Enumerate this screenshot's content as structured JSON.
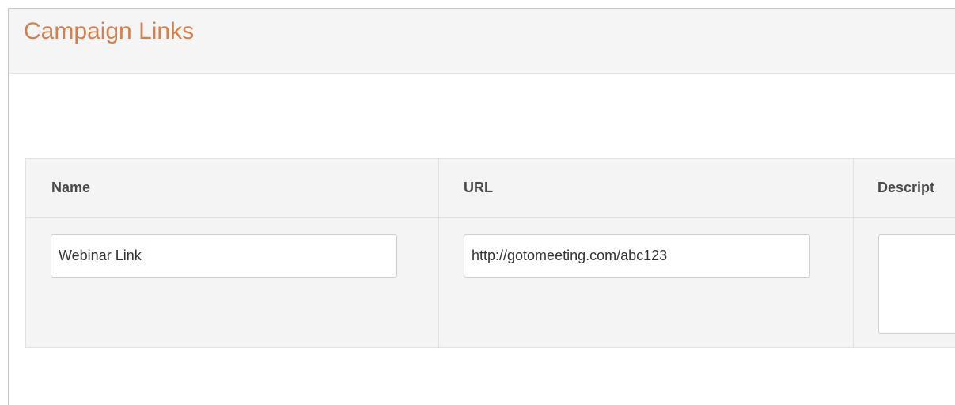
{
  "header": {
    "title": "Campaign Links"
  },
  "table": {
    "columns": {
      "name": "Name",
      "url": "URL",
      "description": "Descript"
    },
    "rows": [
      {
        "name": "Webinar Link",
        "url": "http://gotomeeting.com/abc123",
        "description": ""
      }
    ]
  },
  "colors": {
    "title": "#d4804e",
    "header_bg": "#f5f5f5",
    "table_bg": "#f4f4f4",
    "border": "#e2e2e2"
  }
}
